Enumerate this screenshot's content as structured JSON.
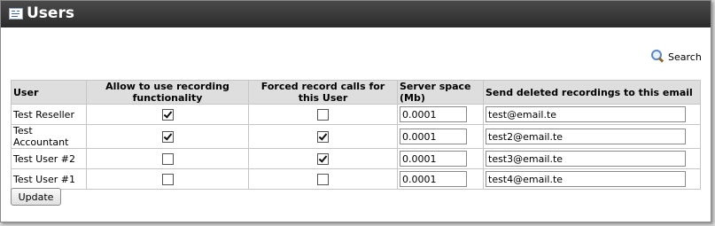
{
  "page": {
    "title": "Users"
  },
  "search": {
    "label": "Search"
  },
  "table": {
    "headers": [
      "User",
      "Allow to use recording functionality",
      "Forced record calls for this User",
      "Server space (Mb)",
      "Send deleted recordings to this email"
    ],
    "rows": [
      {
        "user": "Test Reseller",
        "allow_recording": true,
        "forced_record": false,
        "space": "0.0001",
        "email": "test@email.te"
      },
      {
        "user": "Test Accountant",
        "allow_recording": true,
        "forced_record": true,
        "space": "0.0001",
        "email": "test2@email.te"
      },
      {
        "user": "Test User #2",
        "allow_recording": false,
        "forced_record": true,
        "space": "0.0001",
        "email": "test3@email.te"
      },
      {
        "user": "Test User #1",
        "allow_recording": false,
        "forced_record": false,
        "space": "0.0001",
        "email": "test4@email.te"
      }
    ]
  },
  "actions": {
    "update_label": "Update"
  }
}
